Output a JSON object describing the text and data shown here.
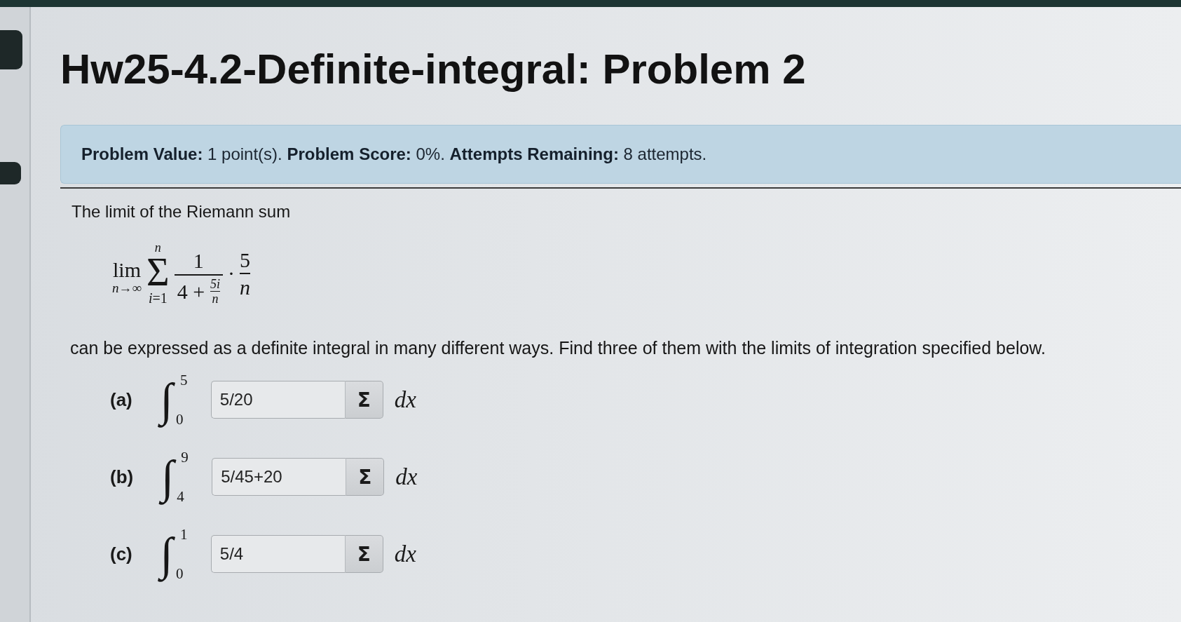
{
  "page": {
    "title": "Hw25-4.2-Definite-integral: Problem 2"
  },
  "problem_status": "**Problem Value:** 1 point(s). **Problem Score:** 0%. **Attempts Remaining:** 8 attempts.",
  "problem": {
    "intro": "The limit of the Riemann sum",
    "riemann_sum": {
      "operator": "lim",
      "limit_subscript": "*n*→∞",
      "sum_symbol": "Σ",
      "sum_upper": "n",
      "sum_lower": "*i*=1",
      "fraction_numerator": "1",
      "denominator_prefix": "4 +",
      "inner_numerator": "5i",
      "inner_denominator": "n",
      "multiply_dot": "·",
      "factor_numerator": "5",
      "factor_denominator": "n"
    },
    "question": "can be expressed as a definite integral in many different ways. Find three of them with the limits of integration specified below.",
    "parts": [
      {
        "label": "(a)",
        "integral_sign": "∫",
        "upper_limit": "5",
        "lower_limit": "0",
        "value": "5/20",
        "button_label": "Σ",
        "differential": "dx"
      },
      {
        "label": "(b)",
        "integral_sign": "∫",
        "upper_limit": "9",
        "lower_limit": "4",
        "value": "5/45+20",
        "button_label": "Σ",
        "differential": "dx"
      },
      {
        "label": "(c)",
        "integral_sign": "∫",
        "upper_limit": "1",
        "lower_limit": "0",
        "value": "5/4",
        "button_label": "Σ",
        "differential": "dx"
      }
    ]
  }
}
